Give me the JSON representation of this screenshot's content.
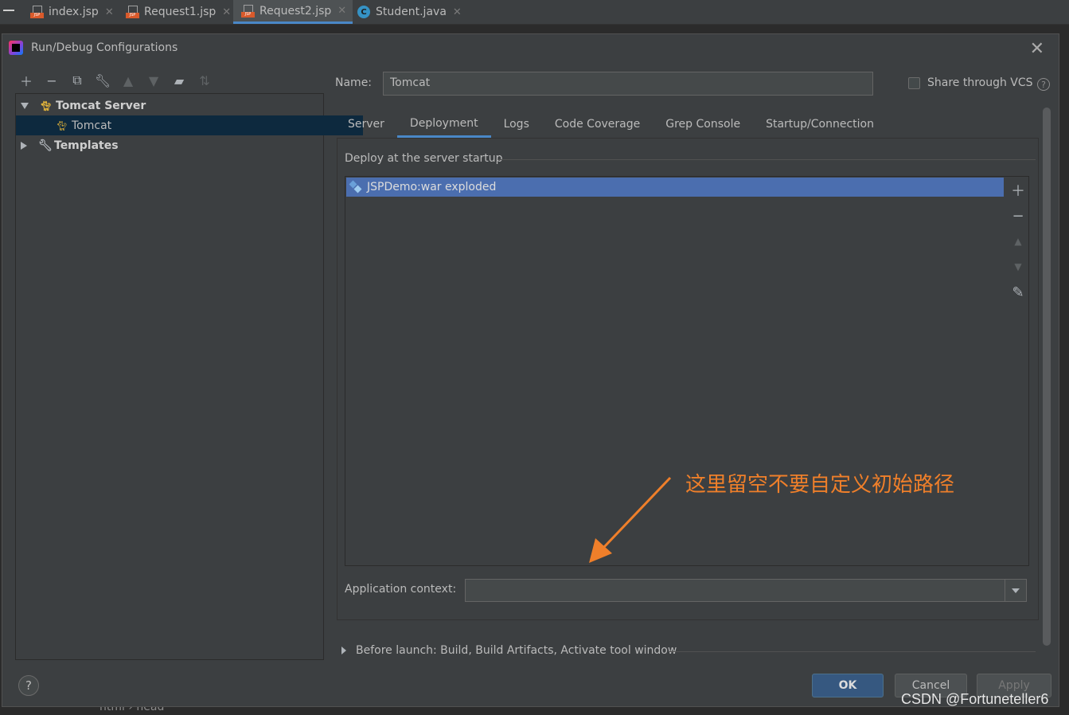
{
  "editor_tabs": [
    {
      "label": "index.jsp",
      "icon": "jsp-file-icon",
      "active": false
    },
    {
      "label": "Request1.jsp",
      "icon": "jsp-file-icon",
      "active": false
    },
    {
      "label": "Request2.jsp",
      "icon": "jsp-file-icon",
      "active": true
    },
    {
      "label": "Student.java",
      "icon": "java-class-icon",
      "active": false
    }
  ],
  "jsp_badge": "JSP",
  "java_badge": "C",
  "dialog": {
    "title": "Run/Debug Configurations",
    "close": "✕"
  },
  "tree": {
    "group": "Tomcat Server",
    "child": "Tomcat",
    "templates": "Templates"
  },
  "name_label": "Name:",
  "name_value": "Tomcat",
  "share_vcs_label": "Share through VCS",
  "help_glyph": "?",
  "config_tabs": [
    "Server",
    "Deployment",
    "Logs",
    "Code Coverage",
    "Grep Console",
    "Startup/Connection"
  ],
  "deploy_section_label": "Deploy at the server startup",
  "deploy_items": [
    "JSPDemo:war exploded"
  ],
  "app_context_label": "Application context:",
  "app_context_value": "",
  "before_launch": "Before launch: Build, Build Artifacts, Activate tool window",
  "buttons": {
    "ok": "OK",
    "cancel": "Cancel",
    "apply": "Apply"
  },
  "annotation_text": "这里留空不要自定义初始路径",
  "watermark": "CSDN @Fortuneteller6",
  "background_editor_text": "html  ›  head",
  "colors": {
    "accent": "#4a88c7",
    "selection": "#4b6eaf",
    "annotation": "#ef7f2a"
  }
}
